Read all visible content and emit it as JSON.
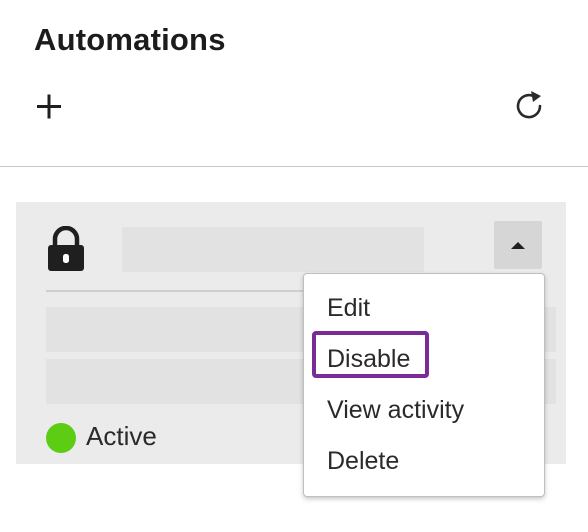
{
  "header": {
    "title": "Automations"
  },
  "toolbar": {
    "add_icon": "plus-icon",
    "refresh_icon": "refresh-icon"
  },
  "automation_card": {
    "lock_icon": "lock-icon",
    "expand_icon": "caret-up-icon",
    "status": {
      "label": "Active",
      "color": "#5ccd12"
    }
  },
  "context_menu": {
    "items": [
      {
        "label": "Edit"
      },
      {
        "label": "Disable",
        "highlighted": true
      },
      {
        "label": "View activity"
      },
      {
        "label": "Delete"
      }
    ],
    "highlight_color": "#7a2b96"
  }
}
